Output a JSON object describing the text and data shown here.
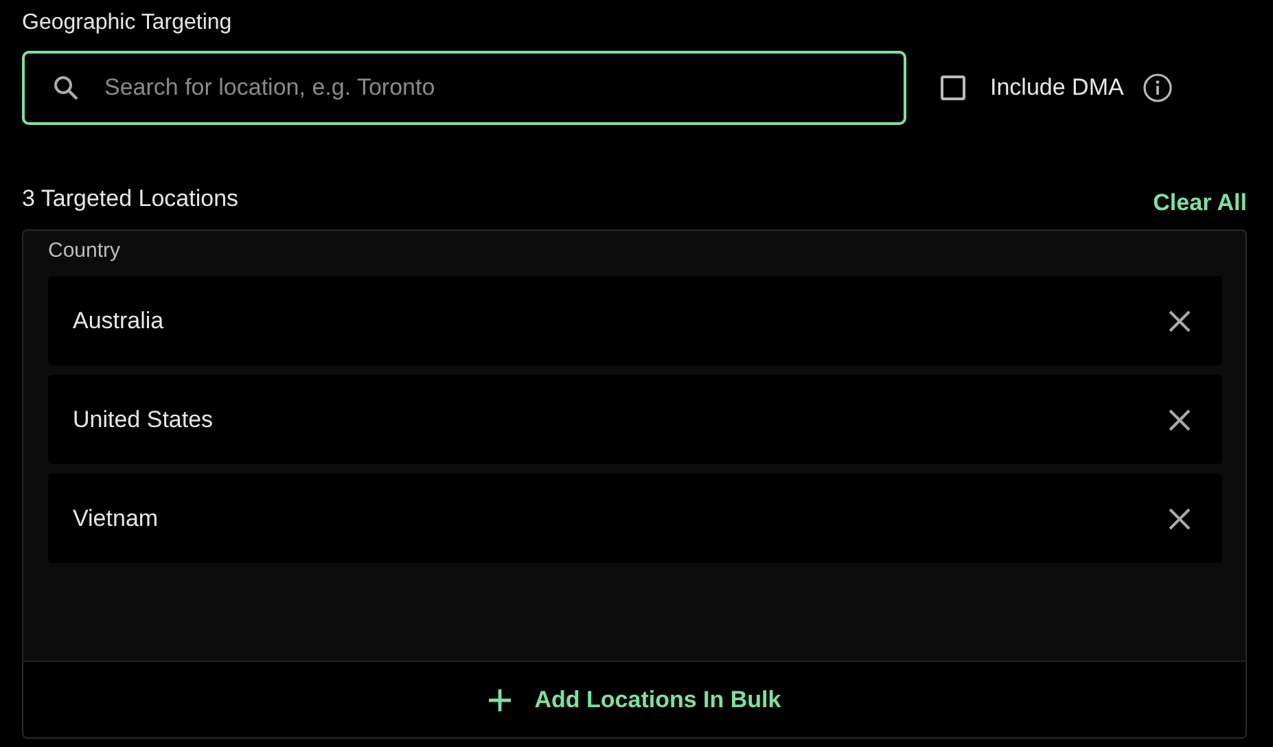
{
  "section_title": "Geographic Targeting",
  "search": {
    "placeholder": "Search for location, e.g. Toronto",
    "focused": true
  },
  "include_dma": {
    "label": "Include DMA",
    "checked": false
  },
  "targeted_heading": "3 Targeted Locations",
  "clear_all": "Clear All",
  "group_label": "Country",
  "locations": [
    {
      "name": "Australia"
    },
    {
      "name": "United States"
    },
    {
      "name": "Vietnam"
    }
  ],
  "bulk_button": "Add Locations In Bulk"
}
